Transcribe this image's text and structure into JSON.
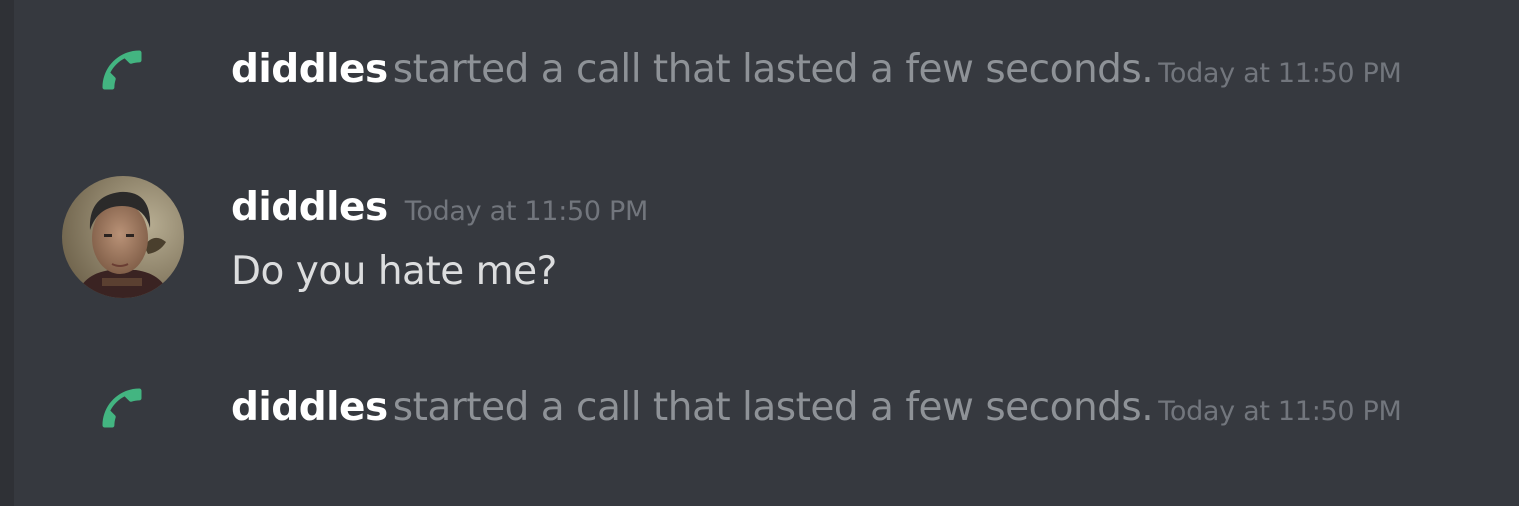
{
  "messages": [
    {
      "kind": "call",
      "icon": "phone-icon",
      "icon_color": "#43b581",
      "author": "diddles",
      "text": "started a call that lasted a few seconds.",
      "timestamp": "Today at 11:50 PM"
    },
    {
      "kind": "message",
      "avatar": "avatar-icon",
      "author": "diddles",
      "timestamp": "Today at 11:50 PM",
      "text": "Do you hate me?"
    },
    {
      "kind": "call",
      "icon": "phone-icon",
      "icon_color": "#43b581",
      "author": "diddles",
      "text": "started a call that lasted a few seconds.",
      "timestamp": "Today at 11:50 PM"
    }
  ],
  "colors": {
    "background": "#36393f",
    "author": "#ffffff",
    "system_text": "#8e9297",
    "timestamp": "#72767d",
    "message_text": "#dcddde"
  }
}
